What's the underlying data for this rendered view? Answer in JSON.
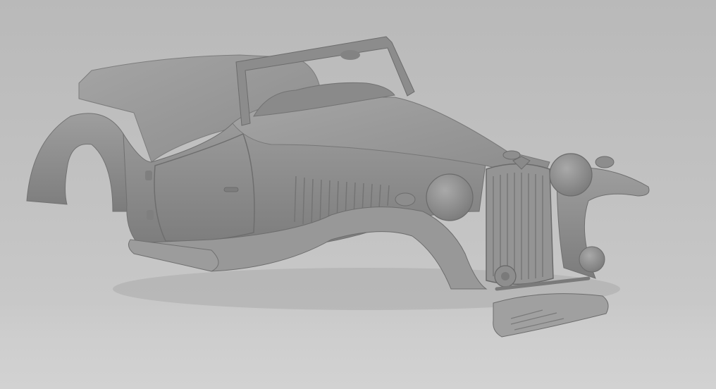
{
  "scene": {
    "subject": "",
    "colors": {
      "background_top": "#b9b9b9",
      "background_bottom": "#cdcdcd",
      "model_base": "#8f8f8f",
      "model_light": "#a6a6a6",
      "model_shadow": "#6f6f6f"
    }
  }
}
